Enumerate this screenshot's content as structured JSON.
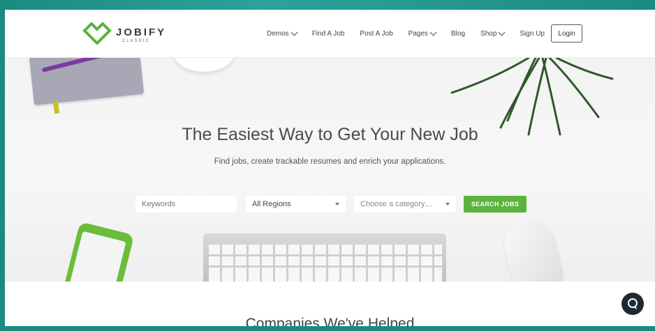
{
  "brand": {
    "name": "JOBIFY",
    "tagline": "CLASSIC",
    "accent": "#5ab33c",
    "frame": "#1c8a81"
  },
  "nav": {
    "items": [
      {
        "label": "Demos",
        "dropdown": true
      },
      {
        "label": "Find A Job",
        "dropdown": false
      },
      {
        "label": "Post A Job",
        "dropdown": false
      },
      {
        "label": "Pages",
        "dropdown": true
      },
      {
        "label": "Blog",
        "dropdown": false
      },
      {
        "label": "Shop",
        "dropdown": true
      },
      {
        "label": "Sign Up",
        "dropdown": false
      }
    ],
    "login_label": "Login"
  },
  "hero": {
    "title": "The Easiest Way to Get Your New Job",
    "subtitle": "Find jobs, create trackable resumes and enrich your applications.",
    "search": {
      "keywords_placeholder": "Keywords",
      "region_value": "All Regions",
      "category_placeholder": "Choose a category…",
      "button_label": "SEARCH JOBS"
    }
  },
  "section": {
    "companies_title": "Companies We've Helped"
  },
  "icons": {
    "chat": "chat-bubble-icon",
    "logo": "heart-outline-icon",
    "caret": "caret-down-icon"
  }
}
